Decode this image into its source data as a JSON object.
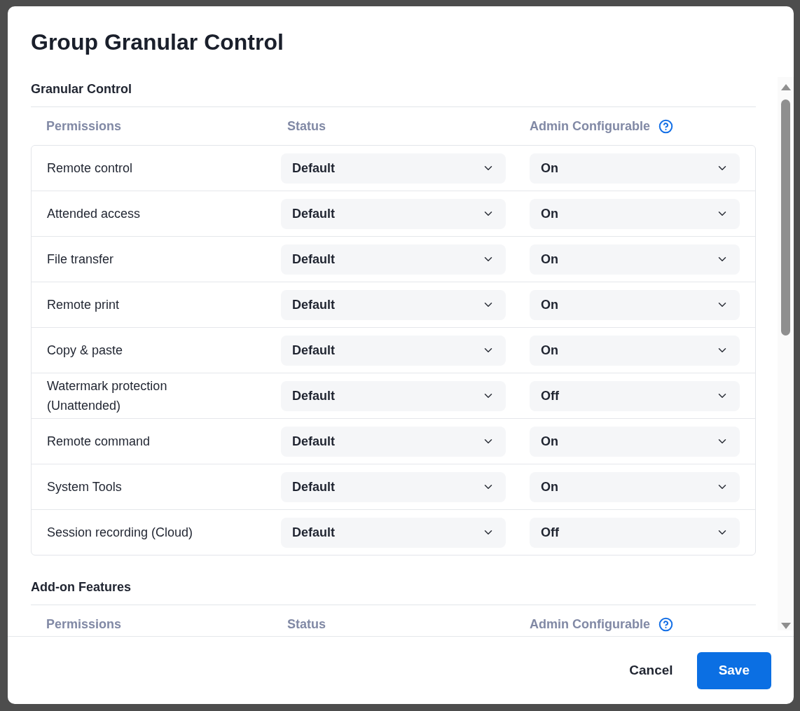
{
  "dialog": {
    "title": "Group Granular Control"
  },
  "sections": [
    {
      "title": "Granular Control",
      "columns": [
        {
          "label": "Permissions",
          "help": false
        },
        {
          "label": "Status",
          "help": false
        },
        {
          "label": "Admin Configurable",
          "help": true
        }
      ],
      "rows": [
        {
          "permission": "Remote control",
          "status": "Default",
          "admin_configurable": "On"
        },
        {
          "permission": "Attended access",
          "status": "Default",
          "admin_configurable": "On"
        },
        {
          "permission": "File transfer",
          "status": "Default",
          "admin_configurable": "On"
        },
        {
          "permission": "Remote print",
          "status": "Default",
          "admin_configurable": "On"
        },
        {
          "permission": "Copy & paste",
          "status": "Default",
          "admin_configurable": "On"
        },
        {
          "permission": "Watermark protection (Unattended)",
          "status": "Default",
          "admin_configurable": "Off"
        },
        {
          "permission": "Remote command",
          "status": "Default",
          "admin_configurable": "On"
        },
        {
          "permission": "System Tools",
          "status": "Default",
          "admin_configurable": "On"
        },
        {
          "permission": "Session recording (Cloud)",
          "status": "Default",
          "admin_configurable": "Off"
        }
      ]
    },
    {
      "title": "Add-on Features",
      "columns": [
        {
          "label": "Permissions",
          "help": false
        },
        {
          "label": "Status",
          "help": false
        },
        {
          "label": "Admin Configurable",
          "help": true
        }
      ]
    }
  ],
  "buttons": [
    {
      "label": "Cancel",
      "kind": "secondary"
    },
    {
      "label": "Save",
      "kind": "primary"
    }
  ]
}
